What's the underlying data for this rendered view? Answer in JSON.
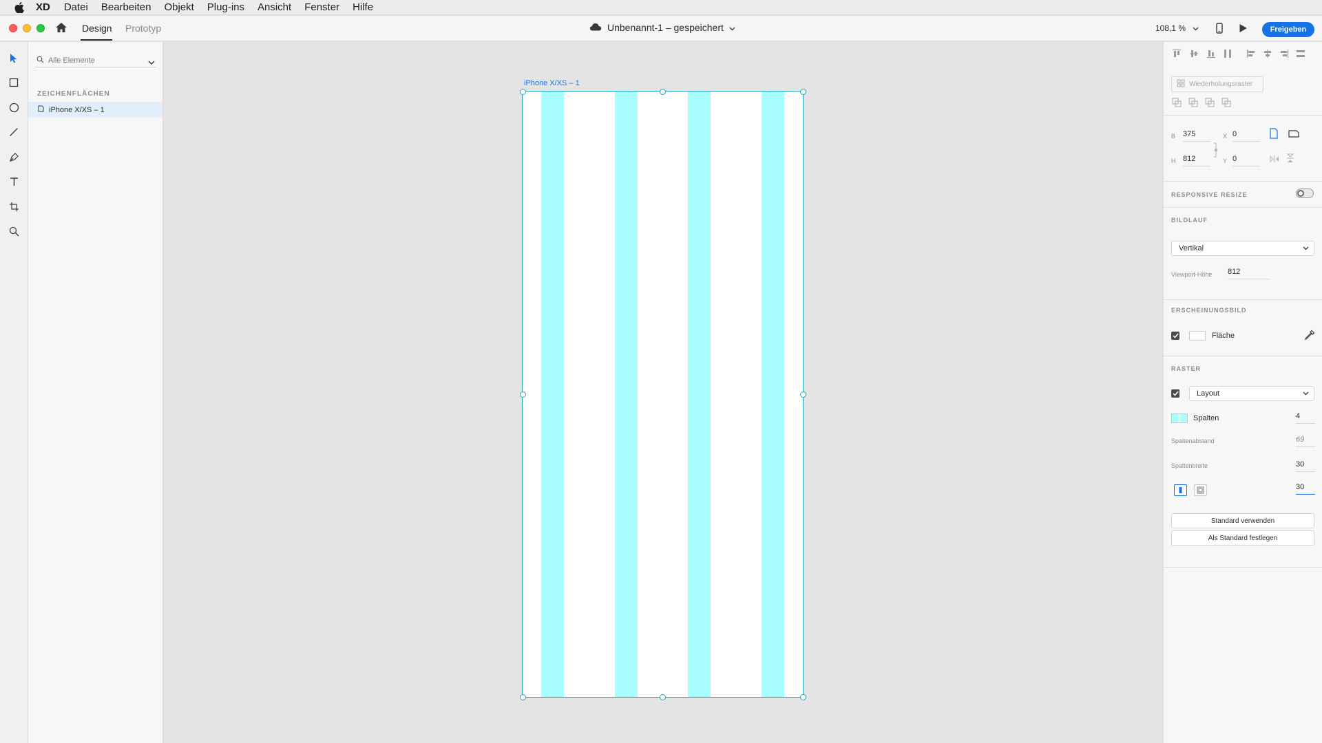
{
  "menubar": {
    "app": "XD",
    "items": [
      "Datei",
      "Bearbeiten",
      "Objekt",
      "Plug-ins",
      "Ansicht",
      "Fenster",
      "Hilfe"
    ]
  },
  "titlebar": {
    "tab_design": "Design",
    "tab_prototype": "Prototyp",
    "document_title": "Unbenannt-1 – gespeichert",
    "zoom": "108,1 %",
    "share_label": "Freigeben"
  },
  "layers": {
    "search_placeholder": "Alle Elemente",
    "section_title": "ZEICHENFLÄCHEN",
    "artboards": [
      "iPhone X/XS – 1"
    ]
  },
  "canvas": {
    "artboard_label": "iPhone X/XS – 1"
  },
  "inspector": {
    "repeat_grid": "Wiederholungsraster",
    "width_label": "B",
    "width_value": "375",
    "height_label": "H",
    "height_value": "812",
    "x_label": "X",
    "x_value": "0",
    "y_label": "Y",
    "y_value": "0",
    "responsive_resize": "RESPONSIVE RESIZE",
    "scroll_section": "BILDLAUF",
    "scroll_value": "Vertikal",
    "viewport_label": "Viewport-Höhe",
    "viewport_value": "812",
    "appearance_section": "ERSCHEINUNGSBILD",
    "fill_label": "Fläche",
    "grid_section": "RASTER",
    "grid_type": "Layout",
    "columns_label": "Spalten",
    "columns_value": "4",
    "gutter_label": "Spaltenabstand",
    "gutter_value": "69",
    "column_width_label": "Spaltenbreite",
    "column_width_value": "30",
    "margin_value": "30",
    "use_default": "Standard verwenden",
    "set_default": "Als Standard festlegen"
  },
  "colors": {
    "accent": "#1473e6",
    "grid_column": "#a8fefe",
    "selection": "#1ea7b4"
  }
}
